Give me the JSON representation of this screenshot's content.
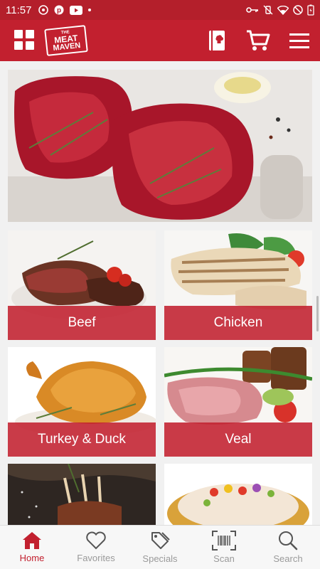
{
  "status": {
    "time": "11:57"
  },
  "app": {
    "logo_the": "THE",
    "logo_meat": "MEAT",
    "logo_maven": "MAVEN"
  },
  "categories": [
    {
      "label": "Beef"
    },
    {
      "label": "Chicken"
    },
    {
      "label": "Turkey & Duck"
    },
    {
      "label": "Veal"
    }
  ],
  "nav": [
    {
      "label": "Home",
      "icon": "home-icon",
      "active": true
    },
    {
      "label": "Favorites",
      "icon": "heart-icon",
      "active": false
    },
    {
      "label": "Specials",
      "icon": "tags-icon",
      "active": false
    },
    {
      "label": "Scan",
      "icon": "barcode-scan-icon",
      "active": false
    },
    {
      "label": "Search",
      "icon": "search-icon",
      "active": false
    }
  ],
  "colors": {
    "brand": "#c2202f",
    "status_bar": "#b41f2b",
    "nav_inactive": "#9a9a9a"
  }
}
